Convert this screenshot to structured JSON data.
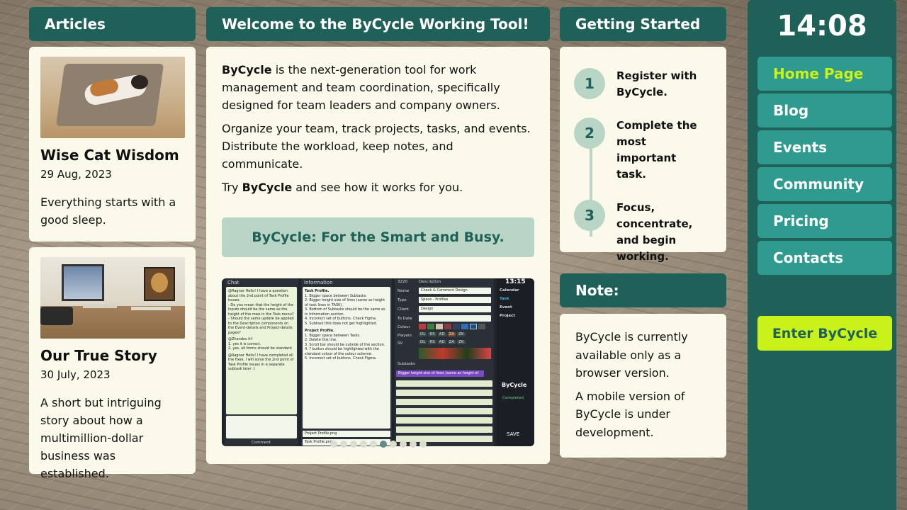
{
  "articles": {
    "header": "Articles",
    "items": [
      {
        "title": "Wise Cat Wisdom",
        "date": "29 Aug, 2023",
        "text": "Everything starts with a good sleep."
      },
      {
        "title": "Our True Story",
        "date": "30 July, 2023",
        "text": "A short but intriguing story about how a multimillion-dollar business was established."
      }
    ]
  },
  "welcome": {
    "header": "Welcome to the ByCycle Working Tool!",
    "brand": "ByCycle",
    "p1_rest": " is the next-generation tool for work management and team coordination, specifically designed for team leaders and company owners.",
    "p2": "Organize your team, track projects, tasks, and events. Distribute the workload, keep notes, and communicate.",
    "p3_pre": "Try ",
    "p3_post": " and see how it works for you.",
    "tagline": "ByCycle: For the Smart and Busy.",
    "carousel": {
      "total": 10,
      "active": 6
    },
    "screenshot": {
      "chat_title": "Chat",
      "chat_button": "Comment",
      "info_title": "Information",
      "desc_id": "3220",
      "desc_title": "Description",
      "fields": [
        {
          "label": "Name",
          "value": "Check & Comment Design"
        },
        {
          "label": "Type",
          "value": "Space - Profiles"
        },
        {
          "label": "Client",
          "value": "Design"
        },
        {
          "label": "To Date",
          "value": ""
        }
      ],
      "colour_label": "Colour",
      "players_label": "Players",
      "sv_label": "SV",
      "players": [
        "DL",
        "RS",
        "AD",
        "ZA",
        "ZK"
      ],
      "subtasks_title": "Subtasks",
      "subtask_first": "Bigger height size of lines (same as height of",
      "time": "13:15",
      "side_menu": [
        "Calendar",
        "Task",
        "Event",
        "Project"
      ],
      "app_name": "ByCycle",
      "status": "Completed",
      "save": "SAVE",
      "info_lines": [
        "Task Profile.",
        "1. Bigger space between Subtasks.",
        "2. Bigger height size of lines (same as height of task lines in TASK).",
        "3. Bottom of Subtasks should be the same as in Information section.",
        "4. Incorrect set of buttons. Check Figma.",
        "5. Subtask title does not get highlighted.",
        "Project Profile.",
        "1. Bigger space between Tasks.",
        "2. Delete this line.",
        "3. Scroll bar should be outside of the section.",
        "4. ? button should be highlighted with the standard colour of the colour scheme.",
        "5. Incorrect set of buttons. Check Figma."
      ],
      "files": [
        "Project Profile.png",
        "Task Profile.png"
      ],
      "chat_lines": [
        "@Ragnar Hello! I have a question about the 2nd point of Task Profile issues.",
        "- Do you mean that the height of the inputs should be the same as the height of the rows in the Task-menu?",
        "- Should the same update be applied to the Description components on the Event-details and Project-details pages?",
        "@Zhandos hi!",
        "1. yes it is correct.",
        "2. yes, all forms should be standard",
        "@Ragnar Hello! I have completed all the fixes. I will solve the 2nd point of Task Profile issues in a separate subtask later :)"
      ]
    }
  },
  "getting_started": {
    "header": "Getting Started",
    "steps": [
      {
        "num": "1",
        "text": "Register with ByCycle."
      },
      {
        "num": "2",
        "text": "Complete the most important task."
      },
      {
        "num": "3",
        "text": "Focus, concentrate, and begin working."
      }
    ]
  },
  "note": {
    "header": "Note:",
    "p1": "ByCycle is currently available only as a browser version.",
    "p2": "A mobile version of ByCycle is under development."
  },
  "sidebar": {
    "clock": "14:08",
    "nav": [
      "Home Page",
      "Blog",
      "Events",
      "Community",
      "Pricing",
      "Contacts"
    ],
    "active_index": 0,
    "enter_label": "Enter ByCycle"
  },
  "colors": {
    "header_bg": "#1f6158",
    "nav_bg": "#2f9a8e",
    "accent": "#c8f21a",
    "card_bg": "#fbfaea",
    "tagline_bg": "#b9d5c6"
  }
}
